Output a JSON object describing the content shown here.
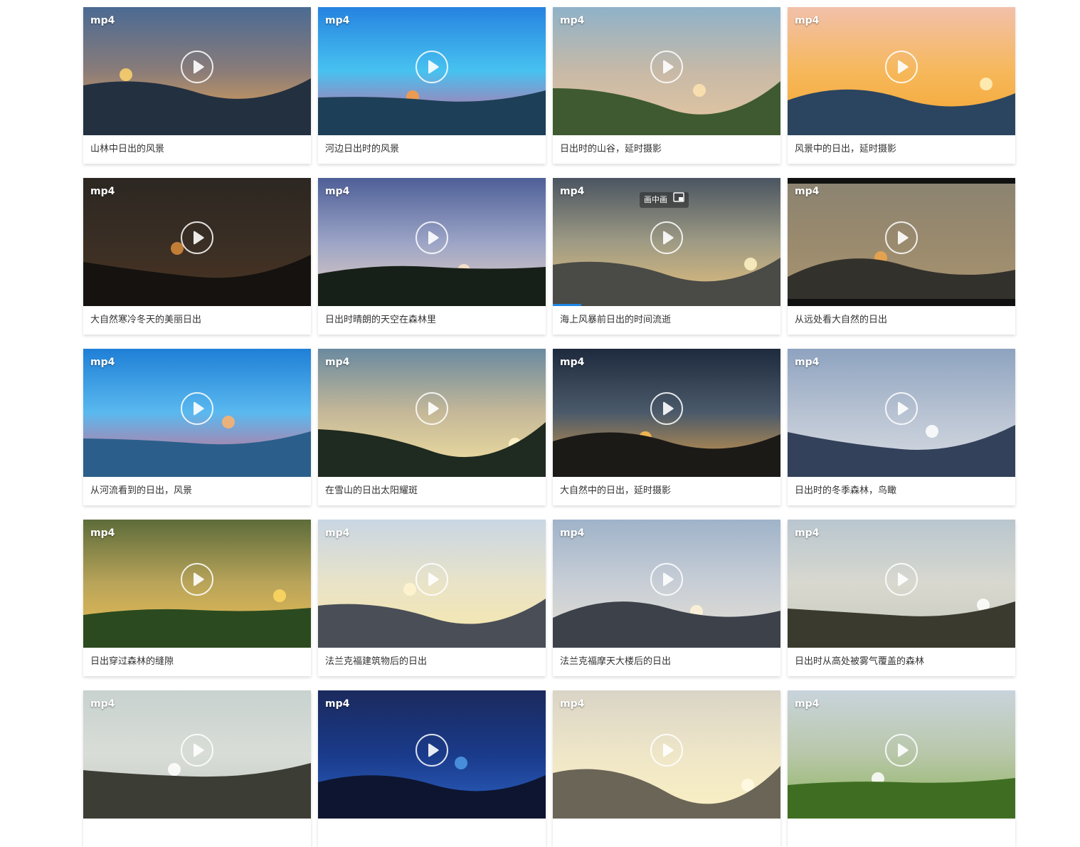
{
  "badge_label": "mp4",
  "pip_label": "画中画",
  "icons": {
    "play": "play-icon",
    "pip": "picture-in-picture-icon"
  },
  "videos": [
    {
      "title": "山林中日出的风景",
      "sky": [
        "#4b6a93",
        "#8a7c79",
        "#f1a94f"
      ],
      "land": "#233040",
      "sun": "#ffd36b"
    },
    {
      "title": "河边日出时的风景",
      "sky": [
        "#2683e0",
        "#47c2f0",
        "#e0568f"
      ],
      "land": "#1d3f57",
      "sun": "#ff9b3d"
    },
    {
      "title": "日出时的山谷，延时摄影",
      "sky": [
        "#8fb2c9",
        "#c7b9a7",
        "#e7c7a0"
      ],
      "land": "#3f5a30",
      "sun": "#ffe4b0"
    },
    {
      "title": "风景中的日出，延时摄影",
      "sky": [
        "#f2c0aa",
        "#f6b85b",
        "#f4a52e"
      ],
      "land": "#2b4460",
      "sun": "#fff2c0"
    },
    {
      "title": "大自然寒冷冬天的美丽日出",
      "sky": [
        "#2c2722",
        "#3a2e24",
        "#4b3422"
      ],
      "land": "#15120f",
      "sun": "#d98b3a"
    },
    {
      "title": "日出时晴朗的天空在森林里",
      "sky": [
        "#4e5f98",
        "#9ba4c6",
        "#e9d0c2"
      ],
      "land": "#172018",
      "sun": "#ffe5c9"
    },
    {
      "title": "海上风暴前日出的时间流逝",
      "sky": [
        "#4a5561",
        "#9e9a84",
        "#e7c27c"
      ],
      "land": "#4a4a46",
      "sun": "#fff3c4"
    },
    {
      "title": "从远处看大自然的日出",
      "sky": [
        "#8a8371",
        "#9a8a6e",
        "#a99570"
      ],
      "land": "#33312c",
      "sun": "#f0a64a"
    },
    {
      "title": "从河流看到的日出，风景",
      "sky": [
        "#1f7fd6",
        "#5ab9ef",
        "#e55f7c"
      ],
      "land": "#2b5e8b",
      "sun": "#ffb36b"
    },
    {
      "title": "在雪山的日出太阳耀斑",
      "sky": [
        "#6a8aa0",
        "#c5b898",
        "#f3e1a1"
      ],
      "land": "#1f2a20",
      "sun": "#fff6cc"
    },
    {
      "title": "大自然中的日出，延时摄影",
      "sky": [
        "#1e2a3e",
        "#4b5a6a",
        "#e2a046"
      ],
      "land": "#1c1a17",
      "sun": "#ffbf4d"
    },
    {
      "title": "日出时的冬季森林，鸟瞰",
      "sky": [
        "#8ea3c0",
        "#b7c2d2",
        "#d9dde3"
      ],
      "land": "#33415a",
      "sun": "#ffffff"
    },
    {
      "title": "日出穿过森林的缝隙",
      "sky": [
        "#5d6c3a",
        "#b9a45a",
        "#f0c152"
      ],
      "land": "#2c4a1f",
      "sun": "#ffd860"
    },
    {
      "title": "法兰克福建筑物后的日出",
      "sky": [
        "#c9d6e4",
        "#e9e3c8",
        "#f7e8a8"
      ],
      "land": "#4a4e57",
      "sun": "#fff6cf"
    },
    {
      "title": "法兰克福摩天大楼后的日出",
      "sky": [
        "#9fb3c9",
        "#c8ced6",
        "#e6e0d2"
      ],
      "land": "#3c414a",
      "sun": "#fff3d6"
    },
    {
      "title": "日出时从高处被雾气覆盖的森林",
      "sky": [
        "#b9c6cf",
        "#d8d8cf",
        "#c7c9bc"
      ],
      "land": "#3a3a2e",
      "sun": "#ffffff"
    },
    {
      "title": "",
      "sky": [
        "#c8d2cf",
        "#d9ddd7",
        "#bfc6bf"
      ],
      "land": "#3c3d35",
      "sun": "#ffffff"
    },
    {
      "title": "",
      "sky": [
        "#1b2a5d",
        "#1a3a8a",
        "#2c63c4"
      ],
      "land": "#0d1530",
      "sun": "#4f9be8"
    },
    {
      "title": "",
      "sky": [
        "#d9d4c6",
        "#efe6c8",
        "#fbf0c2"
      ],
      "land": "#6a6557",
      "sun": "#fffbe4"
    },
    {
      "title": "",
      "sky": [
        "#c9d4dc",
        "#b8c7a9",
        "#8cb35b"
      ],
      "land": "#3f6e22",
      "sun": "#ffffff"
    }
  ]
}
